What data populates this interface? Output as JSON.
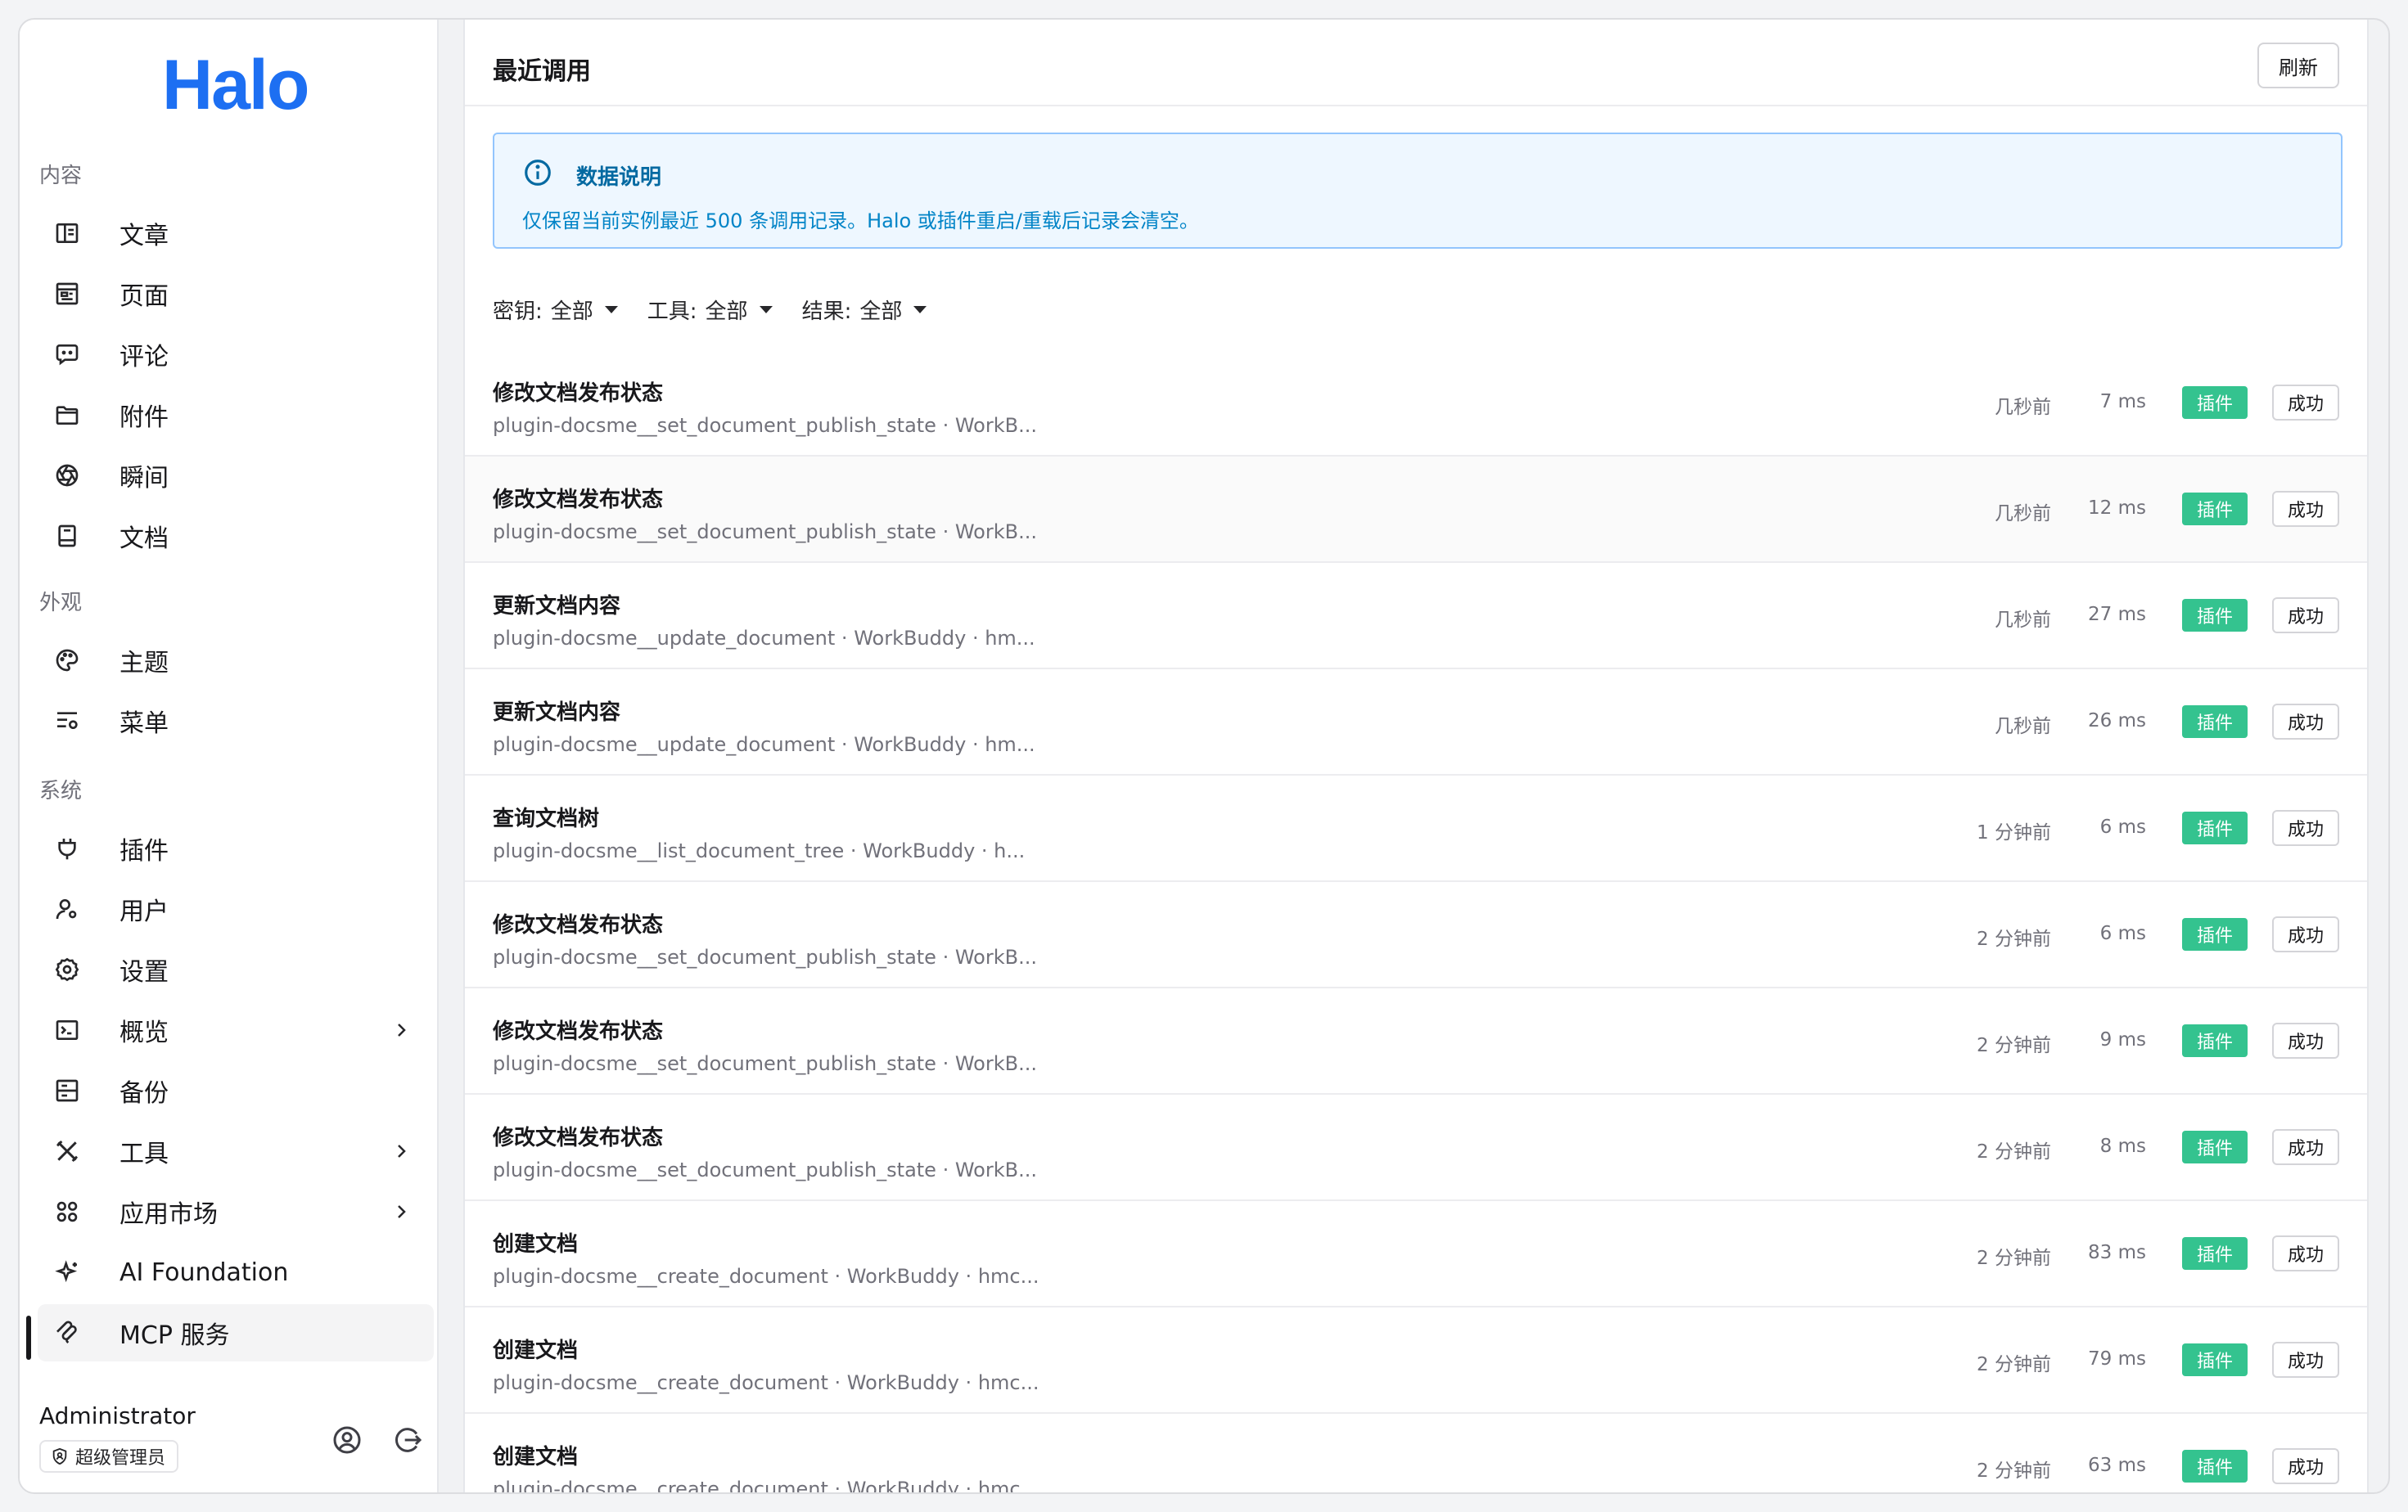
{
  "app": {
    "logo_text": "Halo"
  },
  "sidebar": {
    "sections": [
      {
        "label": "内容",
        "items": [
          {
            "label": "文章",
            "icon": "book-open-icon"
          },
          {
            "label": "页面",
            "icon": "layout-icon"
          },
          {
            "label": "评论",
            "icon": "message-icon"
          },
          {
            "label": "附件",
            "icon": "folder-icon"
          },
          {
            "label": "瞬间",
            "icon": "aperture-icon"
          },
          {
            "label": "文档",
            "icon": "notebook-icon"
          }
        ]
      },
      {
        "label": "外观",
        "items": [
          {
            "label": "主题",
            "icon": "palette-icon"
          },
          {
            "label": "菜单",
            "icon": "menu-list-icon"
          }
        ]
      },
      {
        "label": "系统",
        "items": [
          {
            "label": "插件",
            "icon": "plug-icon"
          },
          {
            "label": "用户",
            "icon": "user-gear-icon"
          },
          {
            "label": "设置",
            "icon": "settings-icon"
          },
          {
            "label": "概览",
            "icon": "terminal-icon",
            "expandable": true
          },
          {
            "label": "备份",
            "icon": "archive-icon"
          },
          {
            "label": "工具",
            "icon": "tools-icon",
            "expandable": true
          },
          {
            "label": "应用市场",
            "icon": "apps-icon",
            "expandable": true
          },
          {
            "label": "AI Foundation",
            "icon": "sparkle-icon"
          },
          {
            "label": "MCP 服务",
            "icon": "mcp-icon",
            "active": true
          }
        ]
      }
    ],
    "user": {
      "name": "Administrator",
      "role": "超级管理员"
    }
  },
  "main": {
    "title": "最近调用",
    "refresh_label": "刷新",
    "info": {
      "title": "数据说明",
      "text": "仅保留当前实例最近 500 条调用记录。Halo 或插件重启/重载后记录会清空。"
    },
    "filters": [
      {
        "label": "密钥:",
        "value": "全部"
      },
      {
        "label": "工具:",
        "value": "全部"
      },
      {
        "label": "结果:",
        "value": "全部"
      }
    ],
    "rows": [
      {
        "title": "修改文档发布状态",
        "sub": "plugin-docsme__set_document_publish_state · WorkB...",
        "time": "几秒前",
        "duration": "7 ms",
        "type": "插件",
        "result": "成功"
      },
      {
        "title": "修改文档发布状态",
        "sub": "plugin-docsme__set_document_publish_state · WorkB...",
        "time": "几秒前",
        "duration": "12 ms",
        "type": "插件",
        "result": "成功"
      },
      {
        "title": "更新文档内容",
        "sub": "plugin-docsme__update_document · WorkBuddy · hm...",
        "time": "几秒前",
        "duration": "27 ms",
        "type": "插件",
        "result": "成功"
      },
      {
        "title": "更新文档内容",
        "sub": "plugin-docsme__update_document · WorkBuddy · hm...",
        "time": "几秒前",
        "duration": "26 ms",
        "type": "插件",
        "result": "成功"
      },
      {
        "title": "查询文档树",
        "sub": "plugin-docsme__list_document_tree · WorkBuddy · h...",
        "time": "1 分钟前",
        "duration": "6 ms",
        "type": "插件",
        "result": "成功"
      },
      {
        "title": "修改文档发布状态",
        "sub": "plugin-docsme__set_document_publish_state · WorkB...",
        "time": "2 分钟前",
        "duration": "6 ms",
        "type": "插件",
        "result": "成功"
      },
      {
        "title": "修改文档发布状态",
        "sub": "plugin-docsme__set_document_publish_state · WorkB...",
        "time": "2 分钟前",
        "duration": "9 ms",
        "type": "插件",
        "result": "成功"
      },
      {
        "title": "修改文档发布状态",
        "sub": "plugin-docsme__set_document_publish_state · WorkB...",
        "time": "2 分钟前",
        "duration": "8 ms",
        "type": "插件",
        "result": "成功"
      },
      {
        "title": "创建文档",
        "sub": "plugin-docsme__create_document · WorkBuddy · hmc...",
        "time": "2 分钟前",
        "duration": "83 ms",
        "type": "插件",
        "result": "成功"
      },
      {
        "title": "创建文档",
        "sub": "plugin-docsme__create_document · WorkBuddy · hmc...",
        "time": "2 分钟前",
        "duration": "79 ms",
        "type": "插件",
        "result": "成功"
      },
      {
        "title": "创建文档",
        "sub": "plugin-docsme__create_document · WorkBuddy · hmc...",
        "time": "2 分钟前",
        "duration": "63 ms",
        "type": "插件",
        "result": "成功"
      }
    ]
  },
  "colors": {
    "brand": "#1d6ff2",
    "plugin_tag": "#34c38f",
    "info_bg": "#eef7ff",
    "info_border": "#93c5fd"
  }
}
